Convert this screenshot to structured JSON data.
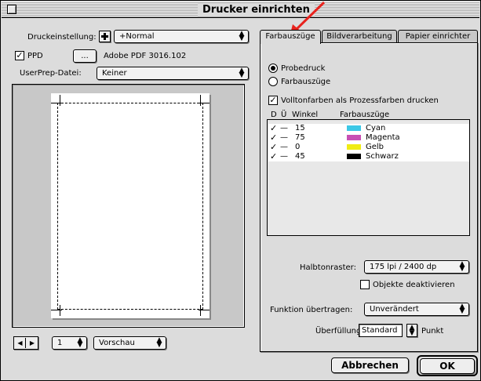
{
  "window": {
    "title": "Drucker einrichten"
  },
  "left": {
    "print_setting_label": "Druckeinstellung:",
    "print_setting_value": "+Normal",
    "ppd_label": "PPD",
    "ppd_button": "...",
    "ppd_value": "Adobe PDF 3016.102",
    "userprep_label": "UserPrep-Datei:",
    "userprep_value": "Keiner",
    "page_value": "1",
    "view_value": "Vorschau"
  },
  "tabs": [
    {
      "label": "Farbauszüge",
      "active": true
    },
    {
      "label": "Bildverarbeitung",
      "active": false
    },
    {
      "label": "Papier einrichter",
      "active": false
    }
  ],
  "separations": {
    "radio_proof": "Probedruck",
    "radio_separations": "Farbauszüge",
    "spot_checkbox": "Volltonfarben als Prozessfarben drucken",
    "col_d": "D",
    "col_u": "Ü",
    "col_angle": "Winkel",
    "col_plates": "Farbauszüge",
    "rows": [
      {
        "check": "✓",
        "dash": "—",
        "angle": "15",
        "name": "Cyan",
        "color": "#3cc8e6"
      },
      {
        "check": "✓",
        "dash": "—",
        "angle": "75",
        "name": "Magenta",
        "color": "#c850b4"
      },
      {
        "check": "✓",
        "dash": "—",
        "angle": "0",
        "name": "Gelb",
        "color": "#f0ec14"
      },
      {
        "check": "✓",
        "dash": "—",
        "angle": "45",
        "name": "Schwarz",
        "color": "#000000"
      }
    ],
    "halftone_label": "Halbtonraster:",
    "halftone_value": "175 lpi / 2400 dp",
    "deactivate_label": "Objekte deaktivieren",
    "transfer_label": "Funktion übertragen:",
    "transfer_value": "Unverändert",
    "trap_label": "Überfüllung:",
    "trap_value": "Standard",
    "trap_unit": "Punkt"
  },
  "buttons": {
    "cancel": "Abbrechen",
    "ok": "OK"
  },
  "colors": {
    "annotation_arrow": "#e8231e"
  }
}
